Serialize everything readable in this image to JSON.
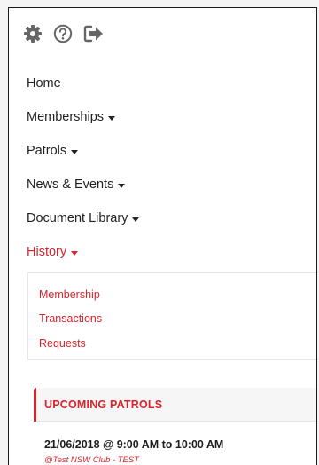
{
  "colors": {
    "accent": "#d9232d",
    "icon": "#666666",
    "text": "#222222"
  },
  "toolbar": {
    "icons": [
      "gear-icon",
      "help-circle-icon",
      "sign-out-icon"
    ]
  },
  "nav": {
    "items": [
      {
        "label": "Home",
        "dropdown": false
      },
      {
        "label": "Memberships",
        "dropdown": true
      },
      {
        "label": "Patrols",
        "dropdown": true
      },
      {
        "label": "News & Events",
        "dropdown": true
      },
      {
        "label": "Document Library",
        "dropdown": true
      },
      {
        "label": "History",
        "dropdown": true,
        "active": true
      }
    ],
    "history_submenu": [
      "Membership",
      "Transactions",
      "Requests"
    ]
  },
  "upcoming_patrols": {
    "title": "UPCOMING PATROLS",
    "entries": [
      {
        "time": "21/06/2018 @ 9:00 AM to 10:00 AM",
        "club": "@Test NSW Club - TEST"
      }
    ]
  }
}
